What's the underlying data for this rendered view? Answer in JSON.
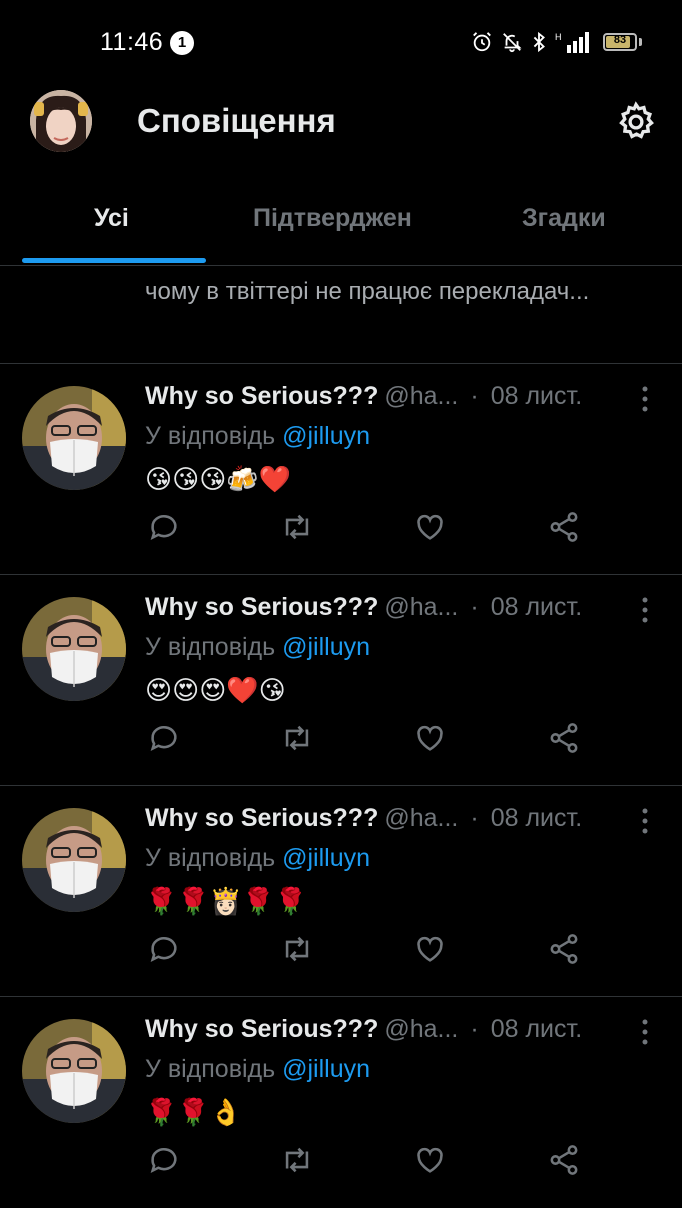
{
  "status_bar": {
    "time": "11:46",
    "notification_count": "1",
    "battery": "83"
  },
  "header": {
    "title": "Сповіщення"
  },
  "tabs": [
    {
      "label": "Усі"
    },
    {
      "label": "Підтверджен"
    },
    {
      "label": "Згадки"
    }
  ],
  "partial_post": {
    "text": "чому в твіттері не працює перекладач..."
  },
  "notifications": [
    {
      "name": "Why so Serious???",
      "handle": "@ha...",
      "dot": "·",
      "date": "08 лист.",
      "reply_prefix": "У відповідь",
      "mention": "@jilluyn",
      "emojis": "😘😘😘🍻❤️"
    },
    {
      "name": "Why so Serious???",
      "handle": "@ha...",
      "dot": "·",
      "date": "08 лист.",
      "reply_prefix": "У відповідь",
      "mention": "@jilluyn",
      "emojis": "😍😍😍❤️😘"
    },
    {
      "name": "Why so Serious???",
      "handle": "@ha...",
      "dot": "·",
      "date": "08 лист.",
      "reply_prefix": "У відповідь",
      "mention": "@jilluyn",
      "emojis": "🌹🌹👸🏻🌹🌹"
    },
    {
      "name": "Why so Serious???",
      "handle": "@ha...",
      "dot": "·",
      "date": "08 лист.",
      "reply_prefix": "У відповідь",
      "mention": "@jilluyn",
      "emojis": "🌹🌹👌"
    }
  ],
  "colors": {
    "background": "#000000",
    "accent": "#1d9bf0",
    "muted": "#71767b",
    "divider": "#2f3336"
  },
  "icons": {
    "status": [
      "alarm-icon",
      "mute-icon",
      "bluetooth-icon",
      "signal-icon",
      "battery-icon"
    ],
    "actions": [
      "reply-icon",
      "retweet-icon",
      "like-icon",
      "share-icon"
    ],
    "header": [
      "settings-gear-icon"
    ]
  }
}
